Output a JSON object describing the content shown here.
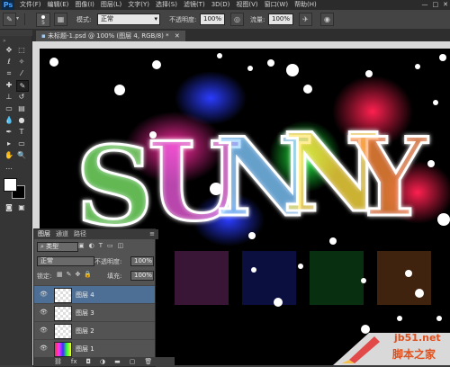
{
  "app": {
    "logo": "Ps"
  },
  "menu": [
    "文件(F)",
    "编辑(E)",
    "图像(I)",
    "图层(L)",
    "文字(Y)",
    "选择(S)",
    "滤镜(T)",
    "3D(D)",
    "视图(V)",
    "窗口(W)",
    "帮助(H)"
  ],
  "window_buttons": [
    "—",
    "□",
    "✕"
  ],
  "options": {
    "brush_size": "5",
    "mode_label": "模式:",
    "mode_value": "正常",
    "opacity_label": "不透明度:",
    "opacity_value": "100%",
    "flow_label": "流量:",
    "flow_value": "100%"
  },
  "document": {
    "tab_title": "未标题-1.psd @ 100% (图层 4, RGB/8) *"
  },
  "canvas": {
    "text": "SUNNY"
  },
  "layers_panel": {
    "tabs": [
      "图层",
      "通道",
      "路径"
    ],
    "kind_label": "类型",
    "blend_mode": "正常",
    "opacity_label": "不透明度:",
    "opacity_value": "100%",
    "lock_label": "锁定:",
    "fill_label": "填充:",
    "fill_value": "100%",
    "layers": [
      {
        "name": "图层 4"
      },
      {
        "name": "图层 3"
      },
      {
        "name": "图层 2"
      },
      {
        "name": "图层 1"
      }
    ],
    "footer_icons": [
      "link-icon",
      "fx-icon",
      "mask-icon",
      "adjustment-icon",
      "group-icon",
      "new-layer-icon",
      "trash-icon"
    ]
  },
  "watermark": {
    "site": "jb51.net",
    "name": "脚本之家"
  }
}
